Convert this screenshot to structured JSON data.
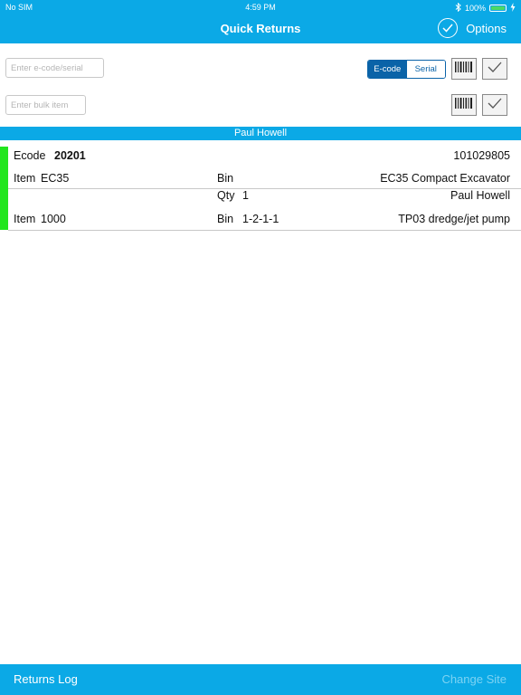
{
  "status_bar": {
    "carrier": "No SIM",
    "time": "4:59 PM",
    "battery": "100%"
  },
  "header": {
    "title": "Quick Returns",
    "options_label": "Options"
  },
  "inputs": {
    "ecode_placeholder": "Enter e-code/serial",
    "bulk_placeholder": "Enter bulk item"
  },
  "segment": {
    "ecode_label": "E-code",
    "serial_label": "Serial",
    "selected": "E-code"
  },
  "banner": {
    "name": "Paul Howell"
  },
  "record": {
    "ecode_label": "Ecode",
    "ecode_value": "20201",
    "ecode_right": "101029805",
    "item1_label": "Item",
    "item1_value": "EC35",
    "bin1_label": "Bin",
    "bin1_value": "",
    "desc1": "EC35 Compact Excavator",
    "qty_label": "Qty",
    "qty_value": "1",
    "person": "Paul Howell",
    "item2_label": "Item",
    "item2_value": "1000",
    "bin2_label": "Bin",
    "bin2_value": "1-2-1-1",
    "desc2": "TP03 dredge/jet pump"
  },
  "footer": {
    "returns_log": "Returns Log",
    "change_site": "Change Site"
  },
  "colors": {
    "brand": "#0ba9e6",
    "segment": "#0a63a8",
    "status_green": "#22e61e"
  }
}
